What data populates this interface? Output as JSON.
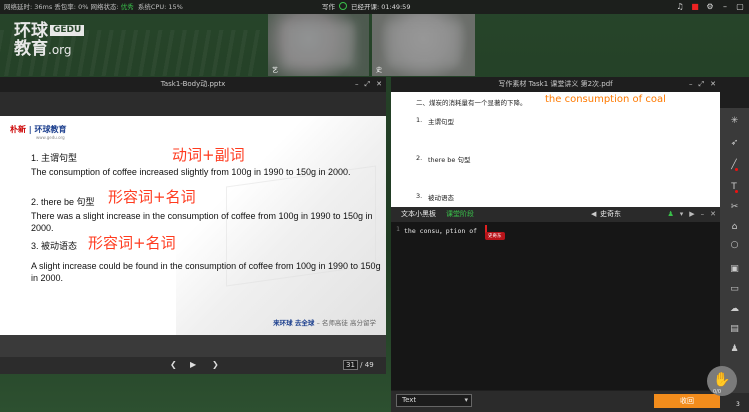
{
  "status": {
    "metrics": "网络延时: 36ms 丢包率: 0% 网络状态:",
    "net_state": "优秀",
    "cpu": "系统CPU: 15%",
    "mode": "写作",
    "class_state": "已经开课: 01:49:59"
  },
  "logo": {
    "cn": "环球",
    "badge": "GEDU",
    "line2": "教育",
    "org": ".org"
  },
  "cams": [
    {
      "name": "艺"
    },
    {
      "name": "史"
    }
  ],
  "ppt": {
    "title": "Task1-Body动.pptx",
    "page_current": "31",
    "page_total": "/ 49",
    "slide": {
      "logo_left": "朴新",
      "logo_right": "环球教育",
      "logo_sub": "www.gedu.org",
      "h1": "1. 主谓句型",
      "p1": "The consumption of coffee increased slightly from 100g in 1990 to 150g in 2000.",
      "h2": "2. there be 句型",
      "p2": "There was a slight increase in the consumption of coffee from 100g in 1990 to 150g in 2000.",
      "h3": "3. 被动语态",
      "p3": "A slight increase could be found in the consumption of coffee from 100g in 1990 to 150g in 2000.",
      "note1": "动词+副词",
      "note2": "形容词+名词",
      "note3": "形容词+名词",
      "footer_main": "来环球 去全球",
      "footer_sub": "– 名师高徒 高分留学"
    }
  },
  "pdf": {
    "title": "写作素材 Task1 课堂讲义 第2次.pdf",
    "line0": "二、煤炭的消耗量有一个显著的下降。",
    "note": "the consumption of coal",
    "i1": "1.",
    "t1": "主谓句型",
    "i2": "2.",
    "t2": "there be 句型",
    "i3": "3.",
    "t3": "被动语态"
  },
  "editor": {
    "tab_notepad": "文本小黑板",
    "tab_stage": "课堂阶段",
    "user": "史奇东",
    "line_no": "1",
    "code": "the consu，ption of",
    "tag": "史奇东"
  },
  "bottom": {
    "select_value": "Text",
    "submit_label": "收回",
    "count": "3"
  },
  "hand": {
    "count": "0/0"
  },
  "colors": {
    "accent": "#39c04a",
    "orange": "#f28c1c",
    "red": "#ff3b1f"
  }
}
